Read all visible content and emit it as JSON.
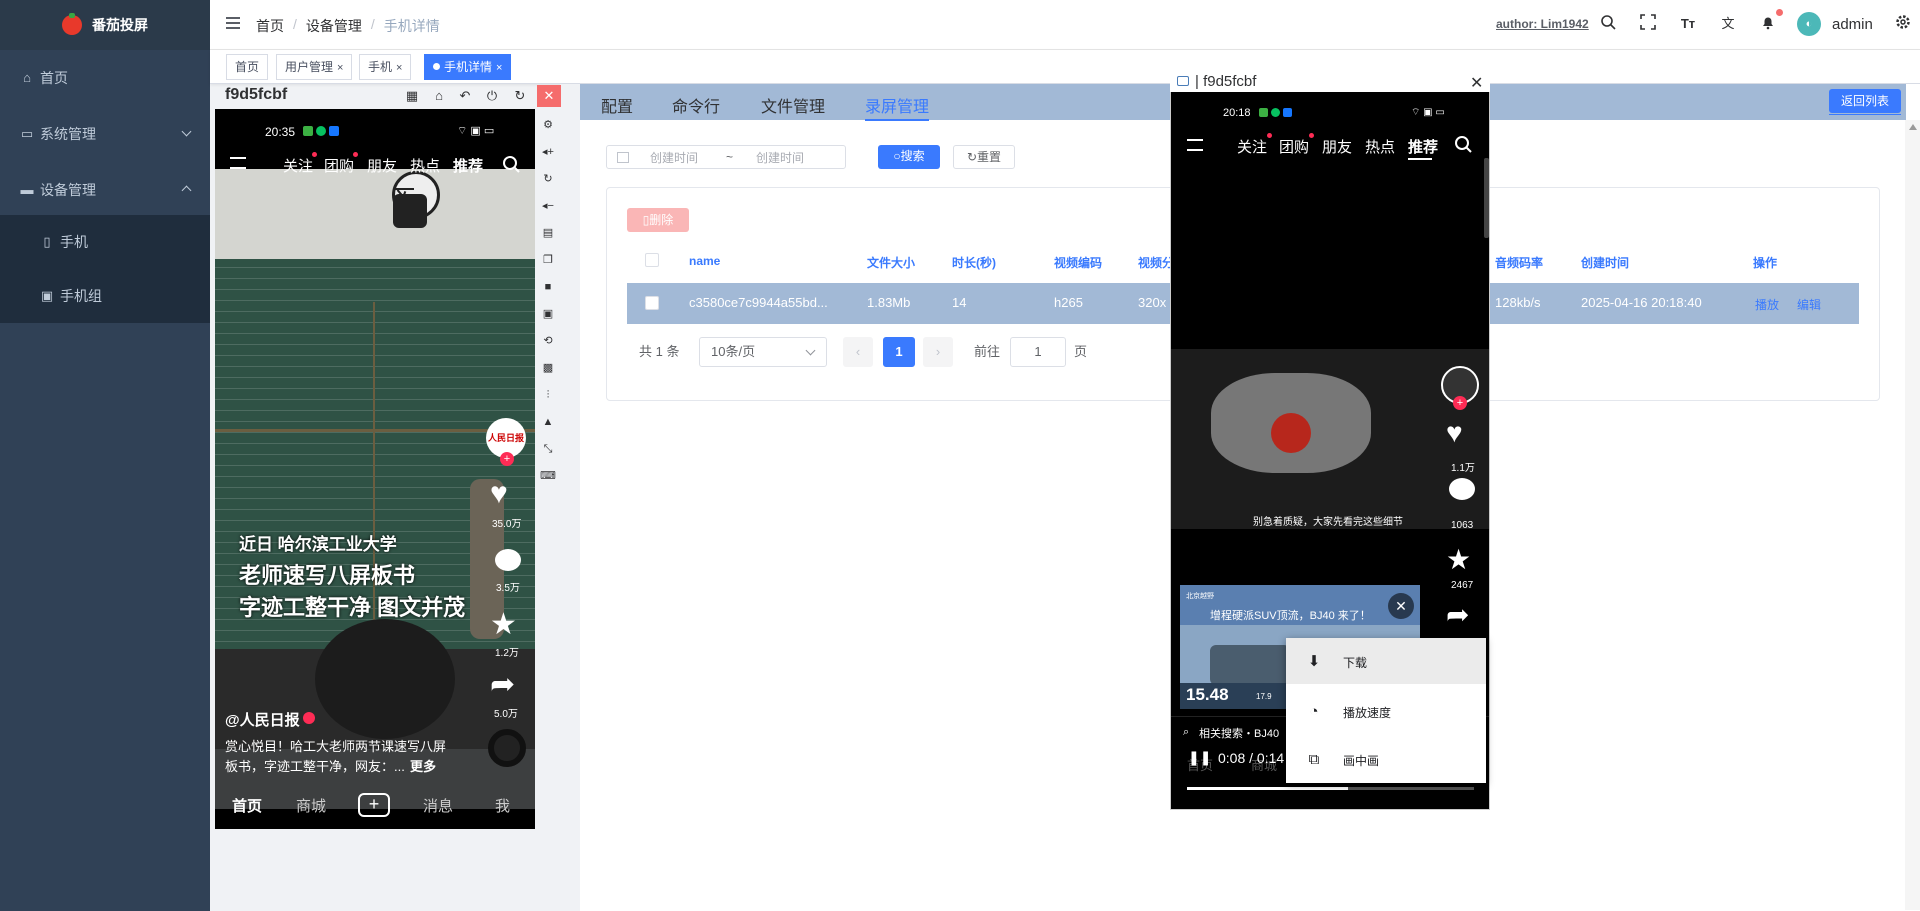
{
  "app": {
    "name": "番茄投屏"
  },
  "sidebar": {
    "items": [
      {
        "label": "首页",
        "icon": "home-icon"
      },
      {
        "label": "系统管理",
        "icon": "monitor-icon"
      },
      {
        "label": "设备管理",
        "icon": "device-icon"
      },
      {
        "label": "手机",
        "icon": "phone-icon"
      },
      {
        "label": "手机组",
        "icon": "phone-group-icon"
      }
    ]
  },
  "navbar": {
    "breadcrumb": [
      "首页",
      "/",
      "设备管理",
      "/",
      "手机详情"
    ],
    "author": "author: Lim1942",
    "user": "admin"
  },
  "tags": [
    {
      "label": "首页"
    },
    {
      "label": "用户管理",
      "close": "×"
    },
    {
      "label": "手机",
      "close": "×"
    },
    {
      "label": "手机详情",
      "close": "×"
    }
  ],
  "device": {
    "id": "f9d5fcbf",
    "close": "✕"
  },
  "left_phone": {
    "time": "20:35",
    "top_tabs": [
      "关注",
      "团购",
      "朋友",
      "热点",
      "推荐"
    ],
    "overlay": [
      "近日 哈尔滨工业大学",
      "老师速写八屏板书",
      "字迹工整干净 图文并茂"
    ],
    "counts": [
      "35.0万",
      "3.5万",
      "1.2万",
      "5.0万"
    ],
    "author": "@人民日报",
    "desc_line1": "赏心悦目！哈工大老师两节课速写八屏",
    "desc_line2": "板书，字迹工整干净，网友：...",
    "more": "更多",
    "bottom_nav": [
      "首页",
      "商城",
      "+",
      "消息",
      "我"
    ],
    "avatar_text": "人民日报"
  },
  "main": {
    "tabs": [
      "配置",
      "命令行",
      "文件管理",
      "录屏管理"
    ],
    "back_button": "返回列表",
    "date_start": "创建时间",
    "date_sep": "~",
    "date_end": "创建时间",
    "search_button": "搜索",
    "reset_button": "重置",
    "delete_button": "删除",
    "columns": [
      "name",
      "文件大小",
      "时长(秒)",
      "视频编码",
      "视频分",
      "音频码率",
      "创建时间",
      "操作"
    ],
    "rows": [
      {
        "name": "c3580ce7c9944a55bd...",
        "size": "1.83Mb",
        "duration": "14",
        "vcodec": "h265",
        "res": "320x",
        "abitrate": "128kb/s",
        "created": "2025-04-16 20:18:40",
        "play": "播放",
        "edit": "编辑"
      }
    ],
    "pagination": {
      "total": "共 1 条",
      "per_page": "10条/页",
      "current": "1",
      "goto": "前往",
      "goto_value": "1",
      "page_suffix": "页"
    }
  },
  "video_window": {
    "title": "| f9d5fcbf",
    "close": "✕",
    "time": "20:18",
    "top_tabs": [
      "关注",
      "团购",
      "朋友",
      "热点",
      "推荐"
    ],
    "subtitle": "别急着质疑，大家先看完这些细节",
    "counts": [
      "1.1万",
      "1063",
      "2467"
    ],
    "ad_line": "增程硬派SUV顶流，BJ40 来了！",
    "ad_price": "15.48",
    "ad_brand": "北京越野",
    "ad_price_suffix": "17.9",
    "related": "相关搜索・BJ40",
    "playtime": "0:08 / 0:14",
    "bottom_peek": [
      "首页",
      "商城"
    ],
    "menu": [
      {
        "label": "下载",
        "icon": "download-icon"
      },
      {
        "label": "播放速度",
        "icon": "playback-speed-icon"
      },
      {
        "label": "画中画",
        "icon": "picture-in-picture-icon"
      }
    ],
    "progress": 0.56
  }
}
